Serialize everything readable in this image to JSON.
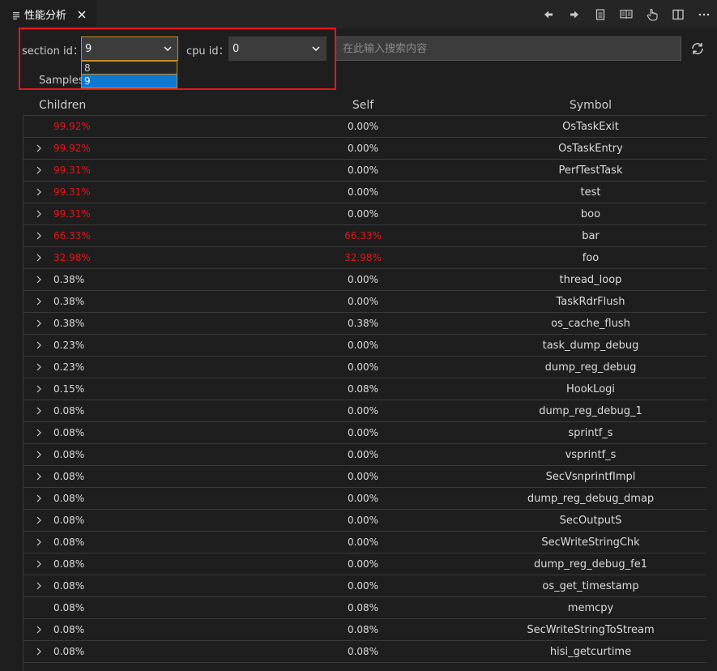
{
  "tab": {
    "title": "性能分析",
    "icon": "list-icon",
    "close_icon": "close-icon"
  },
  "toolbar": {
    "icons": [
      "arrow-left-icon",
      "arrow-right-icon",
      "document-icon",
      "book-icon",
      "hand-pointer-icon",
      "split-editor-icon",
      "more-icon"
    ]
  },
  "filters": {
    "section_label": "section id：",
    "section_value": "9",
    "section_options": [
      "8",
      "9"
    ],
    "section_selected_option": "9",
    "cpu_label": "cpu id：",
    "cpu_value": "0",
    "search_placeholder": "在此输入搜索内容",
    "refresh_icon": "refresh-icon"
  },
  "samples_label": "Samples",
  "colors": {
    "hot": "#e0171b",
    "normal": "#dcdcdc",
    "accent": "#0e78d3",
    "focus": "#c58f23",
    "highlight_box": "#e8161d"
  },
  "table": {
    "headers": {
      "children": "Children",
      "self": "Self",
      "symbol": "Symbol"
    },
    "rows": [
      {
        "expandable": false,
        "children": "99.92%",
        "children_hot": true,
        "self": "0.00%",
        "self_hot": false,
        "symbol": "OsTaskExit"
      },
      {
        "expandable": true,
        "children": "99.92%",
        "children_hot": true,
        "self": "0.00%",
        "self_hot": false,
        "symbol": "OsTaskEntry"
      },
      {
        "expandable": true,
        "children": "99.31%",
        "children_hot": true,
        "self": "0.00%",
        "self_hot": false,
        "symbol": "PerfTestTask"
      },
      {
        "expandable": true,
        "children": "99.31%",
        "children_hot": true,
        "self": "0.00%",
        "self_hot": false,
        "symbol": "test"
      },
      {
        "expandable": true,
        "children": "99.31%",
        "children_hot": true,
        "self": "0.00%",
        "self_hot": false,
        "symbol": "boo"
      },
      {
        "expandable": true,
        "children": "66.33%",
        "children_hot": true,
        "self": "66.33%",
        "self_hot": true,
        "symbol": "bar"
      },
      {
        "expandable": true,
        "children": "32.98%",
        "children_hot": true,
        "self": "32.98%",
        "self_hot": true,
        "symbol": "foo"
      },
      {
        "expandable": true,
        "children": "0.38%",
        "children_hot": false,
        "self": "0.00%",
        "self_hot": false,
        "symbol": "thread_loop"
      },
      {
        "expandable": true,
        "children": "0.38%",
        "children_hot": false,
        "self": "0.00%",
        "self_hot": false,
        "symbol": "TaskRdrFlush"
      },
      {
        "expandable": true,
        "children": "0.38%",
        "children_hot": false,
        "self": "0.38%",
        "self_hot": false,
        "symbol": "os_cache_flush"
      },
      {
        "expandable": true,
        "children": "0.23%",
        "children_hot": false,
        "self": "0.00%",
        "self_hot": false,
        "symbol": "task_dump_debug"
      },
      {
        "expandable": true,
        "children": "0.23%",
        "children_hot": false,
        "self": "0.00%",
        "self_hot": false,
        "symbol": "dump_reg_debug"
      },
      {
        "expandable": true,
        "children": "0.15%",
        "children_hot": false,
        "self": "0.08%",
        "self_hot": false,
        "symbol": "HookLogi"
      },
      {
        "expandable": true,
        "children": "0.08%",
        "children_hot": false,
        "self": "0.00%",
        "self_hot": false,
        "symbol": "dump_reg_debug_1"
      },
      {
        "expandable": true,
        "children": "0.08%",
        "children_hot": false,
        "self": "0.00%",
        "self_hot": false,
        "symbol": "sprintf_s"
      },
      {
        "expandable": true,
        "children": "0.08%",
        "children_hot": false,
        "self": "0.00%",
        "self_hot": false,
        "symbol": "vsprintf_s"
      },
      {
        "expandable": true,
        "children": "0.08%",
        "children_hot": false,
        "self": "0.00%",
        "self_hot": false,
        "symbol": "SecVsnprintfImpl"
      },
      {
        "expandable": true,
        "children": "0.08%",
        "children_hot": false,
        "self": "0.00%",
        "self_hot": false,
        "symbol": "dump_reg_debug_dmap"
      },
      {
        "expandable": true,
        "children": "0.08%",
        "children_hot": false,
        "self": "0.00%",
        "self_hot": false,
        "symbol": "SecOutputS"
      },
      {
        "expandable": true,
        "children": "0.08%",
        "children_hot": false,
        "self": "0.00%",
        "self_hot": false,
        "symbol": "SecWriteStringChk"
      },
      {
        "expandable": true,
        "children": "0.08%",
        "children_hot": false,
        "self": "0.00%",
        "self_hot": false,
        "symbol": "dump_reg_debug_fe1"
      },
      {
        "expandable": true,
        "children": "0.08%",
        "children_hot": false,
        "self": "0.00%",
        "self_hot": false,
        "symbol": "os_get_timestamp"
      },
      {
        "expandable": false,
        "children": "0.08%",
        "children_hot": false,
        "self": "0.08%",
        "self_hot": false,
        "symbol": "memcpy"
      },
      {
        "expandable": true,
        "children": "0.08%",
        "children_hot": false,
        "self": "0.08%",
        "self_hot": false,
        "symbol": "SecWriteStringToStream"
      },
      {
        "expandable": true,
        "children": "0.08%",
        "children_hot": false,
        "self": "0.08%",
        "self_hot": false,
        "symbol": "hisi_getcurtime"
      }
    ]
  }
}
